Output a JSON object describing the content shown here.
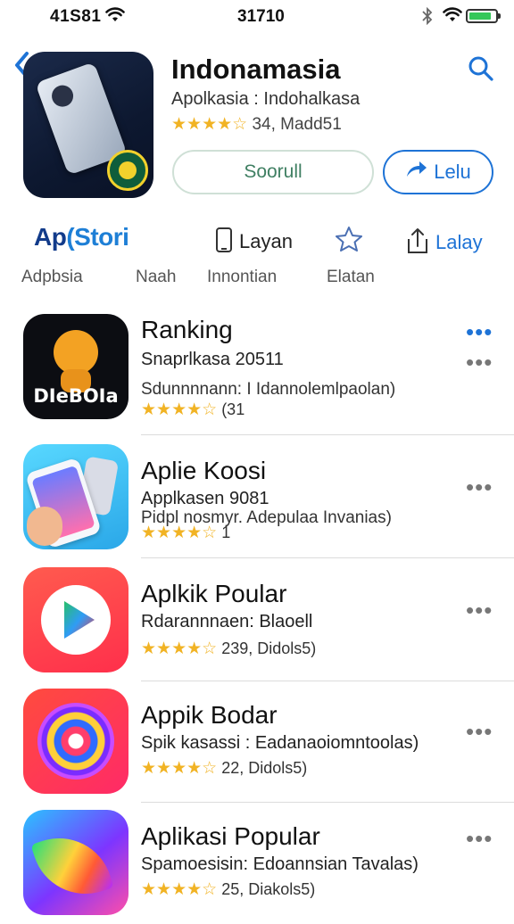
{
  "status_bar": {
    "time_left": "41S81",
    "time_center": "31710"
  },
  "app_header": {
    "title": "Indonamasia",
    "subtitle": "Apolkasia : Indohalkasa",
    "rating_text": "34, Madd51",
    "stars": 4.5,
    "buttons": {
      "primary_label": "Soorull",
      "share_label": "Lelu"
    }
  },
  "tabs": {
    "brand": {
      "prefix": "Ap",
      "accent": "(Stori"
    },
    "items": [
      {
        "label": "Layan",
        "icon": "phone-outline-icon"
      },
      {
        "label": "",
        "icon": "star-outline-icon"
      },
      {
        "label": "Lalay",
        "icon": "share-icon"
      }
    ]
  },
  "subtabs": [
    "Adpbsia",
    "Naah",
    "Innontian",
    "Elatan"
  ],
  "rows": [
    {
      "name": "Ranking",
      "line1": "Snaprlkasa 20511",
      "line2": "Sdunnnnann: I Idannolemlpaolan)",
      "rating_text": "(31",
      "icon_text": "DIeBOIa",
      "stars": 4.5,
      "more_color": "#1e73d6"
    },
    {
      "name": "Aplie Koosi",
      "line1": "Applkasen 9081",
      "line2": "Pidpl nosmyr. Adepulaa Invanias)",
      "rating_text": "1",
      "stars": 4.5,
      "more_color": "#777777"
    },
    {
      "name": "Aplkik Poular",
      "line1": "Rdarannnaen: Blaoell",
      "line2": "",
      "rating_text": "239, Didols5)",
      "stars": 4.5,
      "more_color": "#777777"
    },
    {
      "name": "Appik Bodar",
      "line1": "Spik kasassi : Eadanaoiomntoolas)",
      "line2": "",
      "rating_text": "22, Didols5)",
      "stars": 4.5,
      "more_color": "#777777"
    },
    {
      "name": "Aplikasi Popular",
      "line1": "Spamoesisin: Edoannsian Tavalas)",
      "line2": "",
      "rating_text": "25, Diakols5)",
      "stars": 4.5,
      "more_color": "#777777"
    }
  ],
  "accent_color": "#1e73d6",
  "star_color": "#f1b324"
}
